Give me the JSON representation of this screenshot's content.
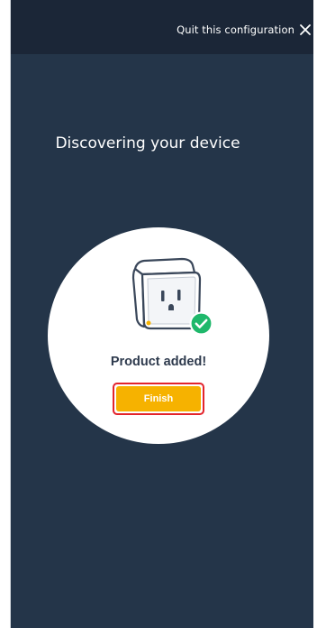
{
  "topbar": {
    "quit_label": "Quit this configuration",
    "quit_icon": "close-icon"
  },
  "main": {
    "heading": "Discovering your device",
    "device_icon": "smart-plug-icon",
    "success_icon": "check-circle-icon",
    "status": "Product added!",
    "finish_label": "Finish"
  },
  "colors": {
    "background": "#243549",
    "topbar": "#1b2637",
    "accent": "#f6b200",
    "success": "#1fb86b",
    "highlight": "#e3242b"
  }
}
